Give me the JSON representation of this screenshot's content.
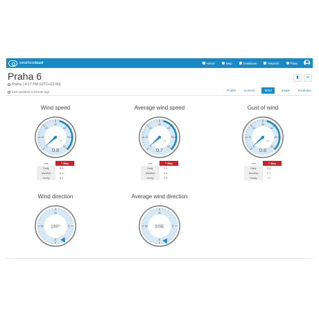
{
  "app": {
    "logo_plain": "weather",
    "logo_bold": "cloud",
    "nav": [
      {
        "label": "Home",
        "icon": "home-icon"
      },
      {
        "label": "Map",
        "icon": "map-marker-icon"
      },
      {
        "label": "Database",
        "icon": "database-icon"
      },
      {
        "label": "Reports",
        "icon": "reports-icon"
      },
      {
        "label": "Pluta",
        "icon": "user-icon"
      }
    ]
  },
  "station": {
    "title": "Praha 6",
    "location": "Praha | 4:17 PM (UTC+02:00)",
    "updated": "Last updated a minute ago"
  },
  "tabs": [
    {
      "label": "Profile",
      "active": false
    },
    {
      "label": "Current",
      "active": false
    },
    {
      "label": "Wind",
      "active": true
    },
    {
      "label": "Inside",
      "active": false
    },
    {
      "label": "Evolution",
      "active": false
    }
  ],
  "colors": {
    "brand": "#1a8ac6",
    "max_badge": "#c0272d",
    "gauge_face": "#d4e8f5"
  },
  "speed_gauges": [
    {
      "title": "Wind speed",
      "value": 0.8,
      "value_text": "0.8",
      "unit": "m/s",
      "scale_labels": [
        "0",
        "10",
        "20",
        "30",
        "40",
        "50",
        "60"
      ],
      "max_label": "Max",
      "rows": [
        {
          "label": "Daily",
          "value": "3.3"
        },
        {
          "label": "Monthly",
          "value": "6.1"
        },
        {
          "label": "Yearly",
          "value": "6.1"
        }
      ]
    },
    {
      "title": "Average wind speed",
      "value": 0.7,
      "value_text": "0.7",
      "unit": "m/s",
      "scale_labels": [
        "0",
        "10",
        "20",
        "30",
        "40",
        "50",
        "60"
      ],
      "max_label": "Max",
      "rows": [
        {
          "label": "Daily",
          "value": "1.1"
        },
        {
          "label": "Monthly",
          "value": "2.4"
        },
        {
          "label": "Yearly",
          "value": "2.4"
        }
      ]
    },
    {
      "title": "Gust of wind",
      "value": 0.8,
      "value_text": "0.8",
      "unit": "m/s",
      "scale_labels": [
        "0",
        "10",
        "20",
        "30",
        "40",
        "50",
        "60"
      ],
      "max_label": "Max",
      "rows": [
        {
          "label": "Daily",
          "value": "3.1"
        },
        {
          "label": "Monthly",
          "value": "7.7"
        },
        {
          "label": "Yearly",
          "value": "7.7"
        }
      ]
    }
  ],
  "direction_gauges": [
    {
      "title": "Wind direction",
      "value_text": "150°",
      "degrees": 150
    },
    {
      "title": "Average wind direction",
      "value_text": "SSE",
      "degrees": 158
    }
  ],
  "compass_labels": {
    "n": "N",
    "e": "E",
    "s": "S",
    "w": "W"
  }
}
